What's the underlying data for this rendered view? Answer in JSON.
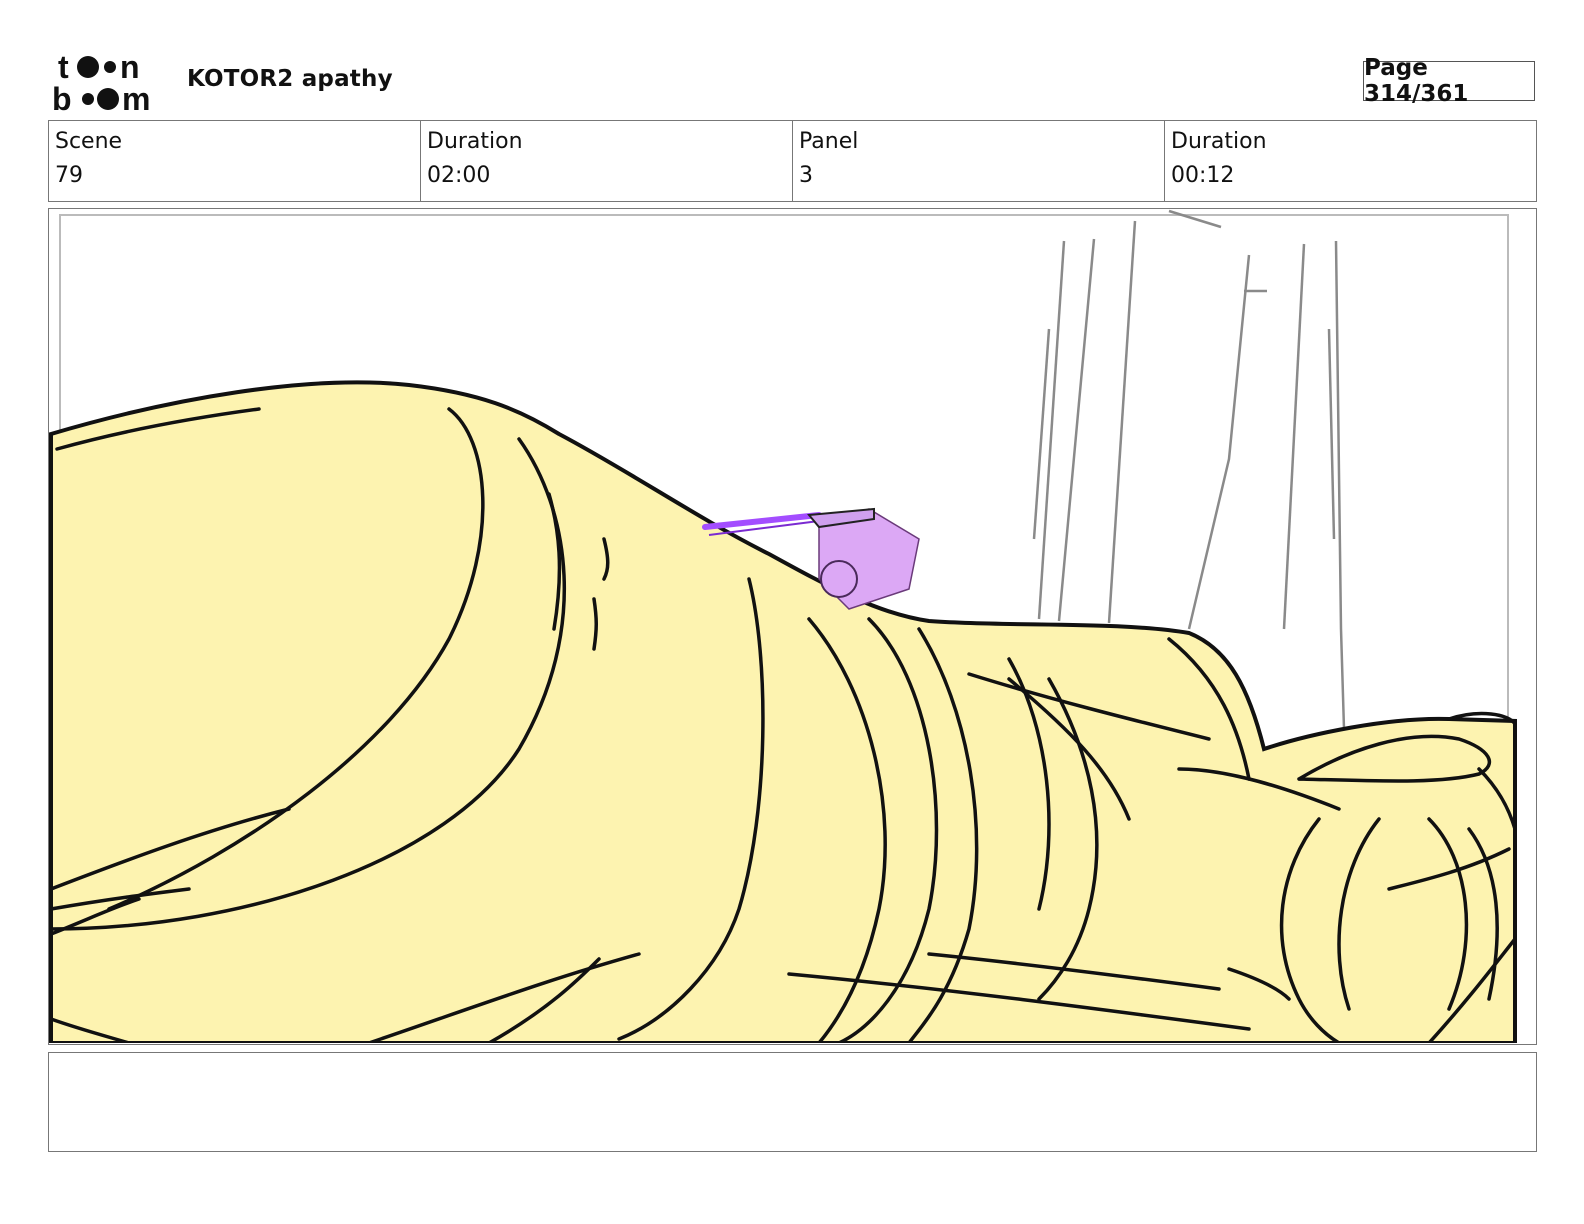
{
  "header": {
    "logo": {
      "icon": "toonboom-logo",
      "text": "toon boom"
    },
    "project_title": "KOTOR2 apathy",
    "page_counter": "Page 314/361"
  },
  "info": {
    "scene_label": "Scene",
    "scene_value": "79",
    "scene_duration_label": "Duration",
    "scene_duration_value": "02:00",
    "panel_label": "Panel",
    "panel_value": "3",
    "panel_duration_label": "Duration",
    "panel_duration_value": "00:12"
  },
  "panel": {
    "image": "storyboard-sketch-icon",
    "colors": {
      "fill": "#fdf3b0",
      "ink": "#111111",
      "accent": "#b04bff",
      "figure": "#dca8f5",
      "pillars": "#8a8a8a"
    }
  },
  "notes": {
    "text": ""
  }
}
